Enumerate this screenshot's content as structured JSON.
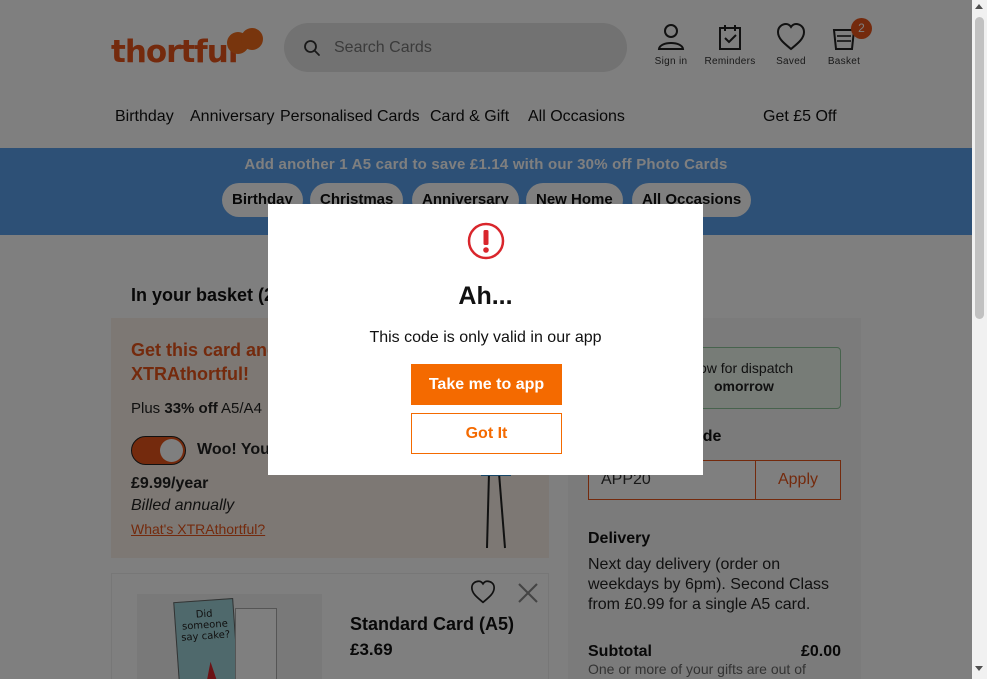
{
  "header": {
    "logo_text": "thortful",
    "search_placeholder": "Search Cards",
    "sign_in": "Sign in",
    "reminders": "Reminders",
    "saved": "Saved",
    "basket": "Basket",
    "basket_count": "2"
  },
  "nav": {
    "birthday": "Birthday",
    "anniversary": "Anniversary",
    "personalised": "Personalised Cards",
    "card_gift": "Card & Gift",
    "all_occasions": "All Occasions",
    "offer": "Get £5 Off"
  },
  "promo": {
    "text": "Add another 1 A5 card to save £1.14 with our 30% off Photo Cards",
    "pills": [
      "Birthday",
      "Christmas",
      "Anniversary",
      "New Home",
      "All Occasions"
    ]
  },
  "basket": {
    "title": "In your basket (2",
    "xtra_head": "Get this card and XTRAthortful!",
    "plus_prefix": "Plus ",
    "plus_bold": "33% off",
    "plus_suffix": " A5/A4",
    "woo": "Woo! You",
    "price": "£9.99/year",
    "billed": "Billed annually",
    "what": "What's XTRAthortful?",
    "item_name": "Standard Card (A5)",
    "item_price": "£3.69",
    "card_art_text": "Did someone say cake?"
  },
  "summary": {
    "dispatch_line1": "ow for dispatch",
    "dispatch_line2": "omorrow",
    "promo_label": "ode",
    "code_value": "APP20",
    "apply": "Apply",
    "delivery_head": "Delivery",
    "delivery_text": "Next day delivery (order on weekdays by 6pm). Second Class from £0.99 for a single A5 card.",
    "subtotal_label": "Subtotal",
    "subtotal_value": "£0.00",
    "subtotal_note": "One or more of your gifts are out of"
  },
  "modal": {
    "title": "Ah...",
    "message": "This code is only valid in our app",
    "primary": "Take me to app",
    "secondary": "Got It",
    "icon": "exclamation-circle-icon"
  },
  "colors": {
    "brand": "#e8541a",
    "button": "#f46a00",
    "promo_bg": "#5aa0ec",
    "alert": "#d9262c"
  }
}
